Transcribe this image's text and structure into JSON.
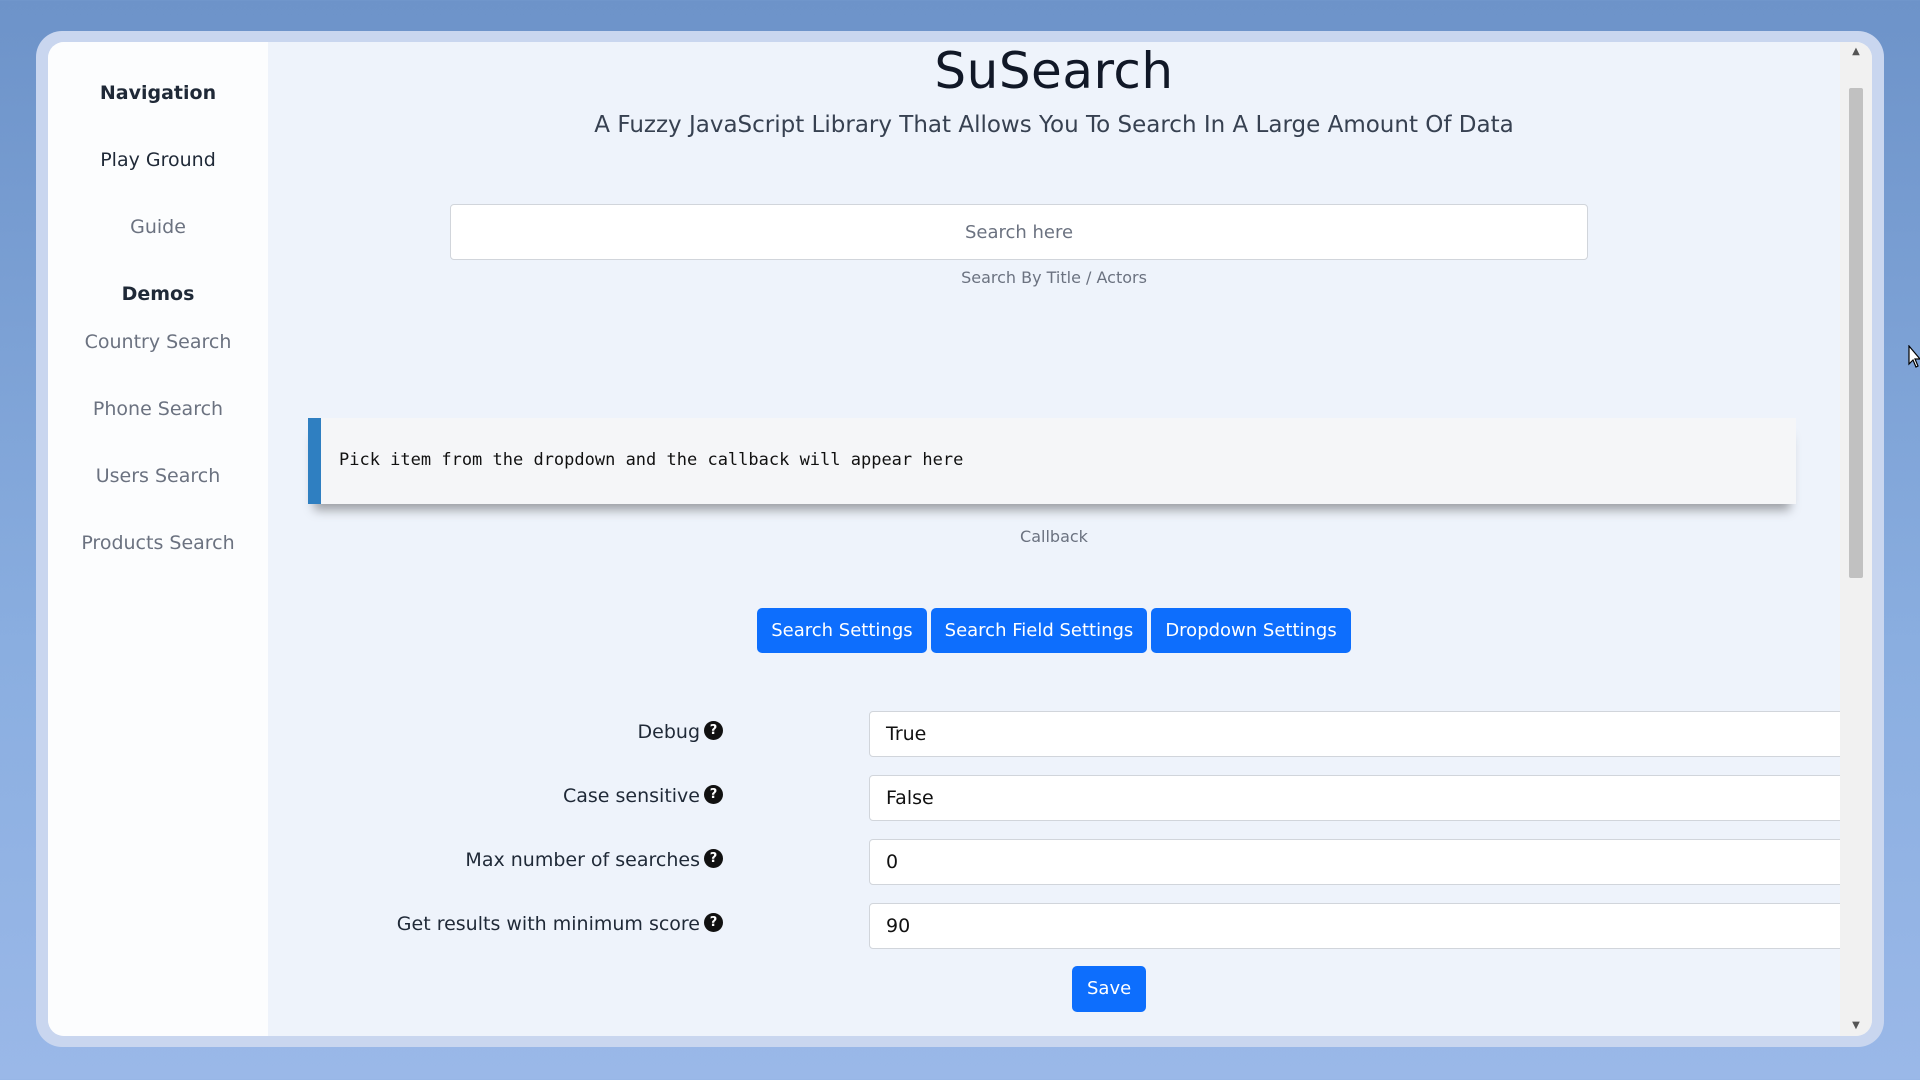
{
  "sidebar": {
    "heading": "Navigation",
    "items": [
      "Play Ground",
      "Guide"
    ],
    "demos_heading": "Demos",
    "demos": [
      "Country Search",
      "Phone Search",
      "Users Search",
      "Products Search"
    ]
  },
  "header": {
    "title": "SuSearch",
    "subtitle": "A Fuzzy JavaScript Library That Allows You To Search In A Large Amount Of Data"
  },
  "search": {
    "placeholder": "Search here",
    "hint": "Search By Title / Actors"
  },
  "callback": {
    "text": "Pick item from the dropdown and the callback will appear here",
    "label": "Callback"
  },
  "tabs": [
    "Search Settings",
    "Search Field Settings",
    "Dropdown Settings"
  ],
  "settings": [
    {
      "label": "Debug",
      "value": "True"
    },
    {
      "label": "Case sensitive",
      "value": "False"
    },
    {
      "label": "Max number of searches",
      "value": "0"
    },
    {
      "label": "Get results with minimum score",
      "value": "90"
    }
  ],
  "save_label": "Save",
  "icons": {
    "help": "question-circle-icon",
    "scroll_up": "triangle-up-icon",
    "scroll_down": "triangle-down-icon",
    "cursor": "mouse-pointer-icon"
  },
  "colors": {
    "accent": "#0d6efd",
    "callback_border": "#2f7fc1",
    "background": "#eef3fb"
  }
}
